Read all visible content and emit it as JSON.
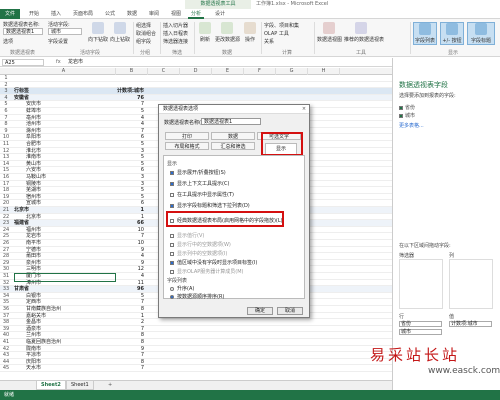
{
  "titlebar": {
    "context_tab": "数据透视表工具",
    "window_title": "工作簿1.xlsx - Microsoft Excel"
  },
  "menu": {
    "file": "文件",
    "tabs": [
      "开始",
      "插入",
      "页面布局",
      "公式",
      "数据",
      "审阅",
      "视图",
      "分析",
      "设计"
    ],
    "active": "分析"
  },
  "ribbon": {
    "pt_name_label": "数据透视表名称:",
    "pt_name_value": "数据透视表1",
    "options_label": "选项",
    "active_field_label": "活动字段:",
    "active_field_value": "城市",
    "field_settings": "字段设置",
    "drill_down": "向下钻取",
    "drill_up": "向上钻取",
    "group_selection": "组选择",
    "ungroup": "取消组合",
    "group_field": "组字段",
    "insert_slicer": "插入切片器",
    "insert_timeline": "插入日程表",
    "filter_conn": "筛选器连接",
    "refresh": "刷新",
    "change_source": "更改数据源",
    "actions": "操作",
    "calc_fields": "字段、项目和集",
    "olap": "OLAP 工具",
    "relationships": "关系",
    "pivotchart": "数据透视图",
    "recommended": "推荐的数据透视表",
    "field_list": "字段列表",
    "buttons": "+/- 按钮",
    "field_headers": "字段标题",
    "groups": [
      "数据透视表",
      "活动字段",
      "分组",
      "筛选",
      "数据",
      "计算",
      "工具",
      "显示"
    ]
  },
  "formula": {
    "cell_ref": "A25",
    "fx": "fx",
    "value": "龙岩市"
  },
  "columns": [
    "A",
    "B",
    "C",
    "D",
    "E",
    "F",
    "G",
    "H"
  ],
  "rows": [
    {
      "n": "1",
      "a": "",
      "b": ""
    },
    {
      "n": "2",
      "a": "",
      "b": ""
    },
    {
      "n": "3",
      "a": "行标签",
      "b": "计数项:城市"
    },
    {
      "n": "4",
      "a": "安徽省",
      "b": "76"
    },
    {
      "n": "5",
      "a": "安庆市",
      "b": "7"
    },
    {
      "n": "6",
      "a": "蚌埠市",
      "b": "5"
    },
    {
      "n": "7",
      "a": "亳州市",
      "b": "4"
    },
    {
      "n": "8",
      "a": "池州市",
      "b": "4"
    },
    {
      "n": "9",
      "a": "滁州市",
      "b": "7"
    },
    {
      "n": "10",
      "a": "阜阳市",
      "b": "6"
    },
    {
      "n": "11",
      "a": "合肥市",
      "b": "5"
    },
    {
      "n": "12",
      "a": "淮北市",
      "b": "3"
    },
    {
      "n": "13",
      "a": "淮南市",
      "b": "5"
    },
    {
      "n": "14",
      "a": "黄山市",
      "b": "5"
    },
    {
      "n": "15",
      "a": "六安市",
      "b": "6"
    },
    {
      "n": "16",
      "a": "马鞍山市",
      "b": "3"
    },
    {
      "n": "17",
      "a": "铜陵市",
      "b": "3"
    },
    {
      "n": "18",
      "a": "芜湖市",
      "b": "5"
    },
    {
      "n": "19",
      "a": "宿州市",
      "b": "5"
    },
    {
      "n": "20",
      "a": "宣城市",
      "b": "6"
    },
    {
      "n": "21",
      "a": "北京市",
      "b": "1"
    },
    {
      "n": "22",
      "a": "北京市",
      "b": "1"
    },
    {
      "n": "23",
      "a": "福建省",
      "b": "66"
    },
    {
      "n": "24",
      "a": "福州市",
      "b": "10"
    },
    {
      "n": "25",
      "a": "龙岩市",
      "b": "7"
    },
    {
      "n": "26",
      "a": "南平市",
      "b": "10"
    },
    {
      "n": "27",
      "a": "宁德市",
      "b": "9"
    },
    {
      "n": "28",
      "a": "莆田市",
      "b": "4"
    },
    {
      "n": "29",
      "a": "泉州市",
      "b": "9"
    },
    {
      "n": "30",
      "a": "三明市",
      "b": "12"
    },
    {
      "n": "31",
      "a": "厦门市",
      "b": "4"
    },
    {
      "n": "32",
      "a": "漳州市",
      "b": "11"
    },
    {
      "n": "33",
      "a": "甘肃省",
      "b": "96"
    },
    {
      "n": "34",
      "a": "白银市",
      "b": "5"
    },
    {
      "n": "35",
      "a": "定西市",
      "b": "7"
    },
    {
      "n": "36",
      "a": "甘南藏族自治州",
      "b": "8"
    },
    {
      "n": "37",
      "a": "嘉峪关市",
      "b": "1"
    },
    {
      "n": "38",
      "a": "金昌市",
      "b": "2"
    },
    {
      "n": "39",
      "a": "酒泉市",
      "b": "7"
    },
    {
      "n": "40",
      "a": "兰州市",
      "b": "8"
    },
    {
      "n": "41",
      "a": "临夏回族自治州",
      "b": "8"
    },
    {
      "n": "42",
      "a": "陇南市",
      "b": "9"
    },
    {
      "n": "43",
      "a": "平凉市",
      "b": "7"
    },
    {
      "n": "44",
      "a": "庆阳市",
      "b": "8"
    },
    {
      "n": "45",
      "a": "天水市",
      "b": "7"
    }
  ],
  "sheets": {
    "tab1": "Sheet2",
    "tab2": "Sheet1",
    "add": "+"
  },
  "status": {
    "text": "就绪"
  },
  "pane": {
    "title": "数据透视表字段",
    "subtitle": "选择要添加到报表的字段:",
    "fields": [
      "省份",
      "城市"
    ],
    "more": "更多表格...",
    "drag_hint": "在以下区域间拖动字段:",
    "filters": "筛选器",
    "columns": "列",
    "rows": "行",
    "values": "值",
    "row_field": "省份",
    "row_field2": "城市",
    "value_field": "计数项:城市"
  },
  "dialog": {
    "title": "数据透视表选项",
    "name_label": "数据透视表名称(N):",
    "name_value": "数据透视表1",
    "tabs_row1": [
      "打印",
      "数据",
      "可选文字"
    ],
    "tabs_row2": [
      "布局和格式",
      "汇总和筛选",
      "显示"
    ],
    "section_display": "显示",
    "opts": [
      "显示展开/折叠按钮(S)",
      "显示上下文工具提示(C)",
      "在工具提示中显示属性(T)",
      "显示字段标题和筛选下拉列表(D)",
      "经典数据透视表布局(启用网格中的字段拖放)(L)",
      "显示值行(V)",
      "显示行中的空数据项(W)",
      "显示列中的空数据项(I)",
      "值区域中没有字段时显示项目标签(I)",
      "显示OLAP服务器计算成员(M)"
    ],
    "section_sort": "字段列表",
    "sort_opts": [
      "升序(A)",
      "按数据源顺序排序(R)"
    ],
    "ok": "确定",
    "cancel": "取消",
    "close": "×"
  },
  "watermark": {
    "cn": "易采站长站",
    "en": "www.easck.com"
  }
}
